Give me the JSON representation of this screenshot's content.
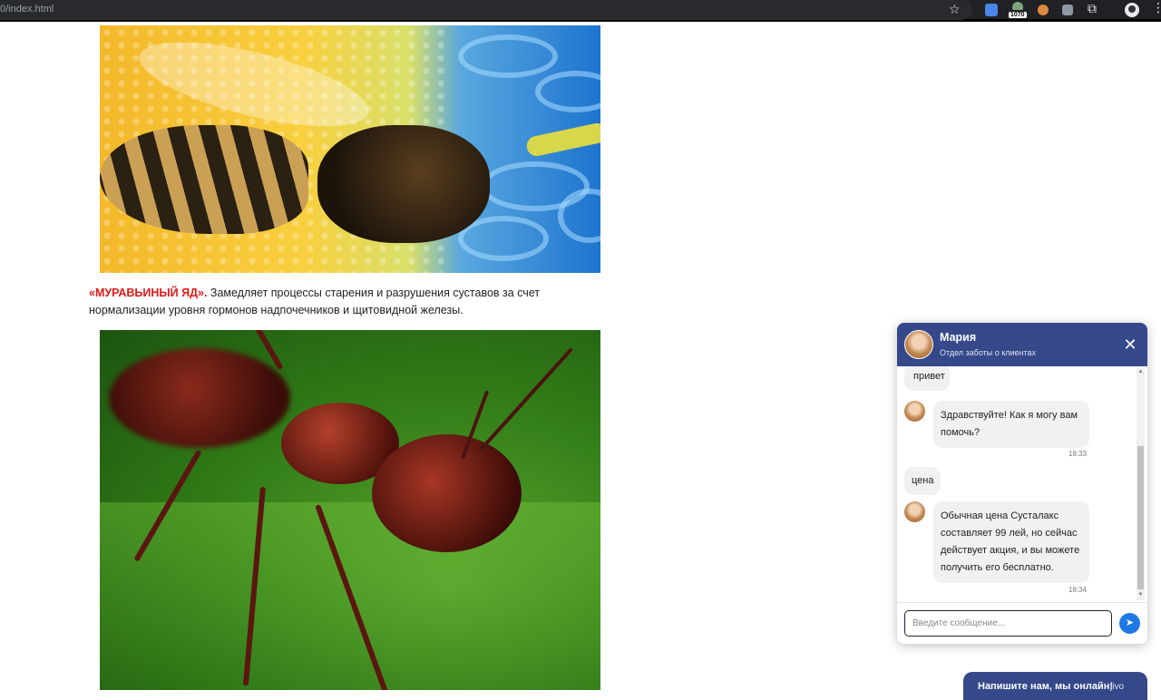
{
  "browser": {
    "url": "0/index.html",
    "extension_badge": "1070",
    "icons": [
      "star-icon",
      "translate-icon",
      "extension-badge-icon",
      "cookie-icon",
      "devtools-icon",
      "puzzle-icon",
      "profile-icon",
      "menu-icon"
    ]
  },
  "article": {
    "highlight": "«МУРАВЬИНЫЙ ЯД».",
    "text": " Замедляет процессы старения и разрушения суставов за счет нормализации уровня гормонов надпочечников и щитовидной железы."
  },
  "chat": {
    "agent_name": "Мария",
    "agent_role": "Отдел заботы о клиентах",
    "messages": [
      {
        "from": "user",
        "text": "привет"
      },
      {
        "from": "agent",
        "text": "Здравствуйте! Как я могу вам помочь?",
        "time": "18:33"
      },
      {
        "from": "user",
        "text": "цена"
      },
      {
        "from": "agent",
        "text": "Обычная цена Сусталакс составляет 99 лей, но сейчас действует акция, и вы можете получить его бесплатно.",
        "time": "18:34"
      }
    ],
    "input_placeholder": "Введите сообщение...",
    "input_value": ""
  },
  "online_button": {
    "label": "Напишите нам, мы онлайн!",
    "brand": "jivo"
  },
  "colors": {
    "chat_header": "#34488a",
    "highlight": "#e11a1a",
    "send_button": "#1e78e6"
  }
}
